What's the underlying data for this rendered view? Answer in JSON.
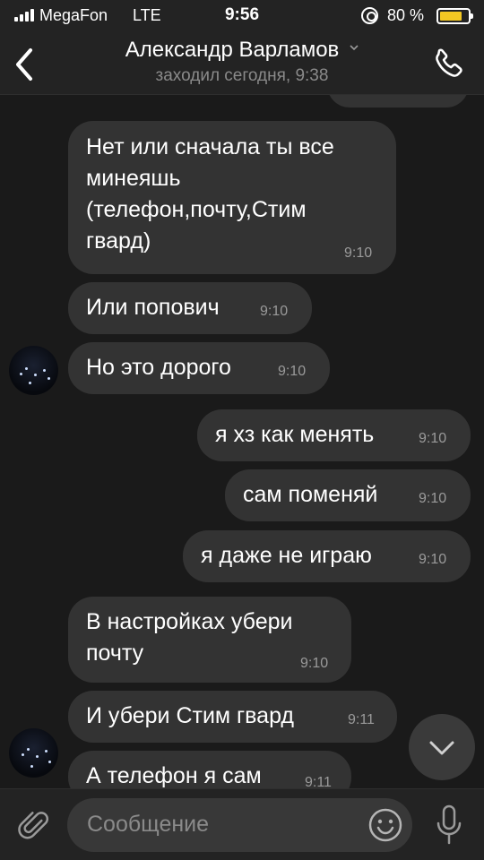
{
  "status_bar": {
    "carrier": "MegaFon",
    "network": "LTE",
    "time": "9:56",
    "battery": "80 %",
    "battery_level": 0.8
  },
  "header": {
    "title": "Александр Варламов",
    "subtitle": "заходил сегодня, 9:38",
    "icons": [
      "back-icon",
      "chevron-down-icon",
      "phone-icon"
    ]
  },
  "messages": [
    {
      "direction": "in",
      "lines": [
        "Нет или сначала ты все",
        "минеяшь",
        "(телефон,почту,Стим",
        "гвард)"
      ],
      "time": "9:10"
    },
    {
      "direction": "in",
      "text": "Или попович",
      "time": "9:10"
    },
    {
      "direction": "in",
      "text": "Но это дорого",
      "time": "9:10"
    },
    {
      "direction": "out",
      "text": "я хз как менять",
      "time": "9:10"
    },
    {
      "direction": "out",
      "text": "сам поменяй",
      "time": "9:10"
    },
    {
      "direction": "out",
      "text": "я даже не играю",
      "time": "9:10"
    },
    {
      "direction": "in",
      "lines": [
        "В настройках убери",
        "почту"
      ],
      "time": "9:10"
    },
    {
      "direction": "in",
      "text": "И убери Стим гвард",
      "time": "9:11"
    },
    {
      "direction": "in",
      "text": "А телефон я сам",
      "time": "9:11"
    }
  ],
  "composer": {
    "placeholder": "Сообщение",
    "icons": [
      "attach-icon",
      "emoji-icon",
      "mic-icon",
      "scroll-down-icon"
    ]
  },
  "colors": {
    "background": "#1a1a1a",
    "bubble": "#333333",
    "header": "#232323",
    "battery": "#f4c823"
  }
}
